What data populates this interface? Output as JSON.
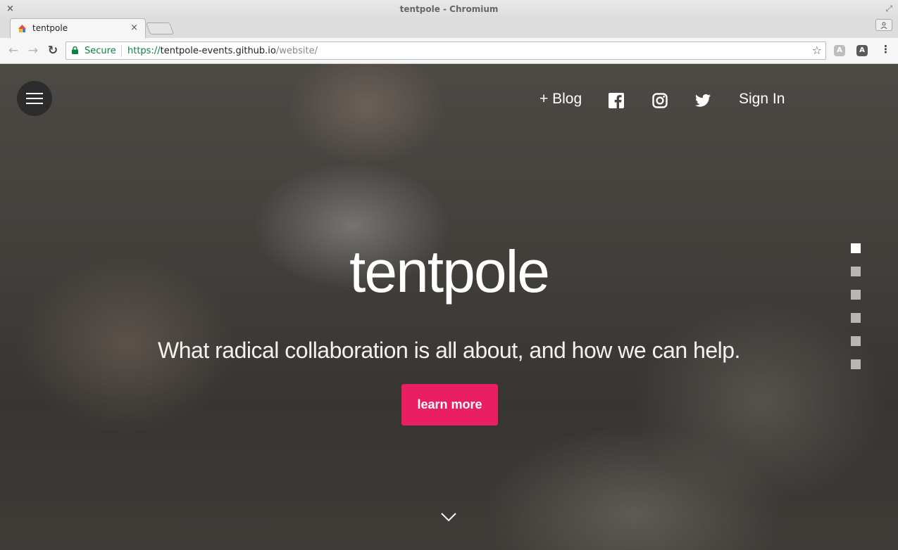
{
  "window": {
    "title": "tentpole - Chromium",
    "close_glyph": "×",
    "maximize_glyph": "⤢"
  },
  "tabs": [
    {
      "title": "tentpole",
      "close_glyph": "×",
      "active": true
    }
  ],
  "toolbar": {
    "back_glyph": "←",
    "forward_glyph": "→",
    "reload_glyph": "↻",
    "security_label": "Secure",
    "url_scheme": "https://",
    "url_host": "tentpole-events.github.io",
    "url_path": "/website/",
    "bookmark_glyph": "☆",
    "menu_glyph": "⋮",
    "extensions": [
      {
        "name": "angular-gray-icon",
        "glyph": "A"
      },
      {
        "name": "angular-dark-icon",
        "glyph": "A"
      }
    ]
  },
  "nav": {
    "blog_label": "+ Blog",
    "social_icons": [
      "facebook-icon",
      "instagram-icon",
      "twitter-icon"
    ],
    "signin_label": "Sign In"
  },
  "hero": {
    "title": "tentpole",
    "subtitle": "What radical collaboration is all about, and how we can help.",
    "cta_label": "learn more"
  },
  "slide_dots": {
    "count": 6,
    "active_index": 0
  },
  "colors": {
    "accent": "#e91e63",
    "secure_green": "#0b8043"
  }
}
